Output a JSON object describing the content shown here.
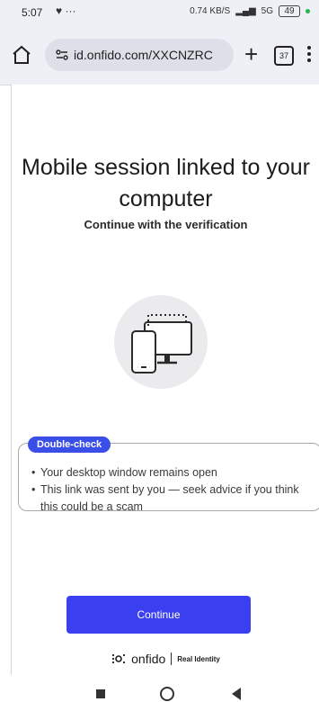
{
  "status_bar": {
    "time": "5:07",
    "extra": "♥ ···",
    "net_speed": "0.74 KB/S",
    "signal_text": "5G",
    "battery": "49"
  },
  "browser": {
    "url": "id.onfido.com/XXCNZRC",
    "tab_count": "37",
    "icons": [
      "home-icon",
      "site-settings-icon",
      "plus-icon",
      "tabs-icon",
      "menu-icon"
    ]
  },
  "page": {
    "title": "Mobile session linked to your computer",
    "subtitle": "Continue with the verification",
    "callout": {
      "badge": "Double-check",
      "items": [
        "Your desktop window remains open",
        "This link was sent by you — seek advice if you think this could be a scam"
      ]
    },
    "continue_label": "Continue",
    "footer": {
      "brand": "onfido",
      "tagline": "Real Identity"
    }
  },
  "colors": {
    "accent": "#3a3ff0",
    "badge": "#3a4ee8",
    "toolbar_bg": "#eef0f5"
  }
}
